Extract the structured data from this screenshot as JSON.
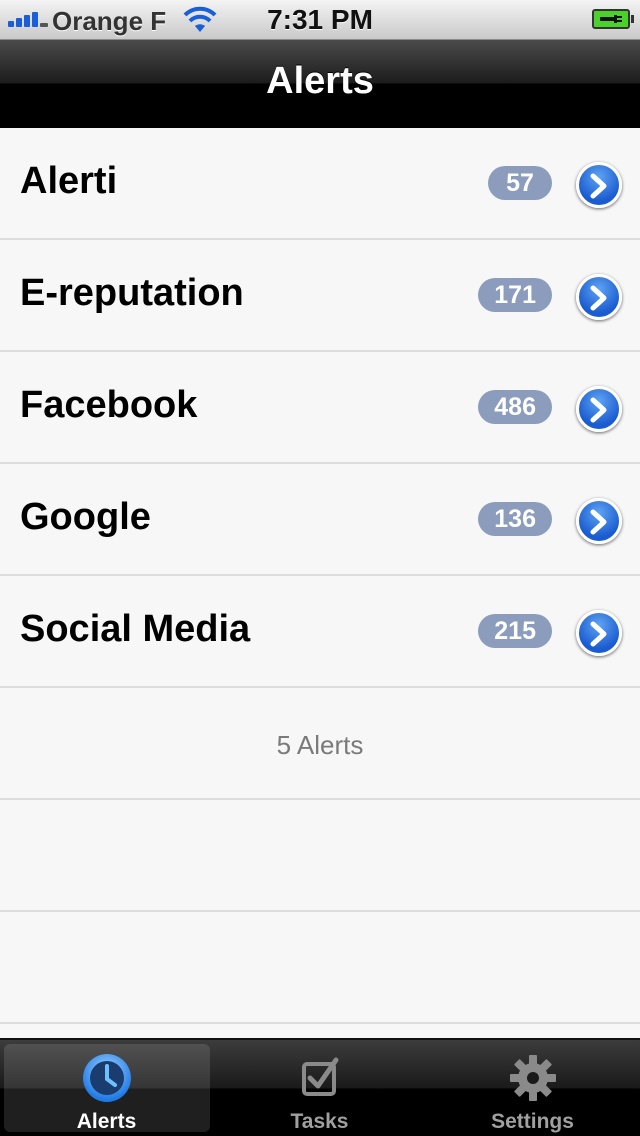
{
  "status_bar": {
    "carrier": "Orange F",
    "time": "7:31 PM"
  },
  "nav": {
    "title": "Alerts"
  },
  "alerts": [
    {
      "label": "Alerti",
      "count": "57"
    },
    {
      "label": "E-reputation",
      "count": "171"
    },
    {
      "label": "Facebook",
      "count": "486"
    },
    {
      "label": "Google",
      "count": "136"
    },
    {
      "label": "Social Media",
      "count": "215"
    }
  ],
  "footer": {
    "summary": "5 Alerts"
  },
  "tabs": [
    {
      "label": "Alerts",
      "icon": "clock-icon",
      "selected": true
    },
    {
      "label": "Tasks",
      "icon": "checkbox-icon",
      "selected": false
    },
    {
      "label": "Settings",
      "icon": "gear-icon",
      "selected": false
    }
  ],
  "colors": {
    "badge": "#8c9cbd",
    "disclosure": "#1a5bd0",
    "accent_blue": "#2a7de0"
  }
}
